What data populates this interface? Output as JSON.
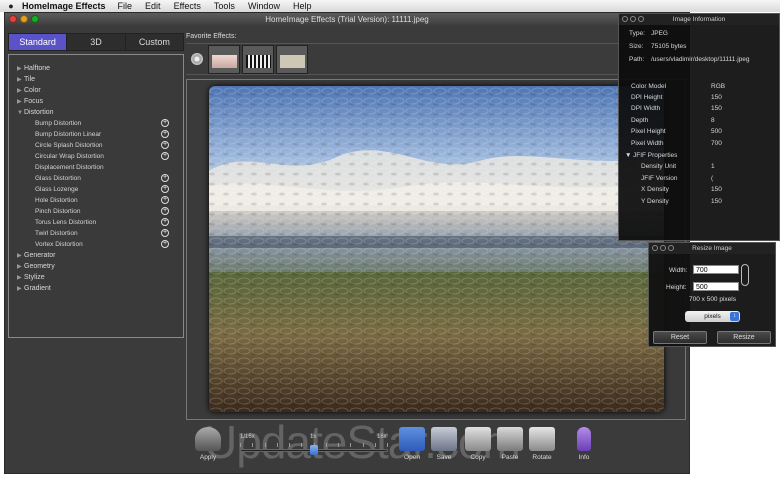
{
  "menubar": {
    "app_name": "HomeImage Effects",
    "items": [
      "File",
      "Edit",
      "Effects",
      "Tools",
      "Window",
      "Help"
    ]
  },
  "window": {
    "title": "HomeImage Effects (Trial Version): 11111.jpeg"
  },
  "tabs": [
    "Standard",
    "3D",
    "Custom"
  ],
  "effects": {
    "categories_top": [
      "Halftone",
      "Tile",
      "Color",
      "Focus"
    ],
    "expanded_category": "Distortion",
    "distortion_items": [
      "Bump Distortion",
      "Bump Distortion Linear",
      "Circle Splash Distortion",
      "Circular Wrap Distortion",
      "Displacement Distortion",
      "Glass Distortion",
      "Glass Lozenge",
      "Hole Distortion",
      "Pinch Distortion",
      "Torus Lens Distortion",
      "Twirl Distortion",
      "Vortex Distortion"
    ],
    "categories_bottom": [
      "Generator",
      "Geometry",
      "Stylize",
      "Gradient"
    ]
  },
  "favorites": {
    "label": "Favorite Effects:"
  },
  "watermark": "UpdateStar.com",
  "toolbar": {
    "apply": "Apply",
    "slider_min": "1/16x",
    "slider_mid": "1x",
    "slider_max": "16x",
    "open": "Open",
    "save": "Save",
    "copy": "Copy",
    "paste": "Paste",
    "rotate": "Rotate",
    "info": "Info"
  },
  "info_panel": {
    "title": "Image Information",
    "type_label": "Type:",
    "type_value": "JPEG",
    "size_label": "Size:",
    "size_value": "75105 bytes",
    "path_label": "Path:",
    "path_value": "/users/vladimir/desktop/11111.jpeg",
    "color_model_label": "Color Model",
    "color_model_value": "RGB",
    "dpi_height_label": "DPI Height",
    "dpi_height_value": "150",
    "dpi_width_label": "DPI Width",
    "dpi_width_value": "150",
    "depth_label": "Depth",
    "depth_value": "8",
    "pixel_height_label": "Pixel Height",
    "pixel_height_value": "500",
    "pixel_width_label": "Pixel Width",
    "pixel_width_value": "700",
    "jfif_label": "JFIF Properties",
    "density_unit_label": "Density Unit",
    "density_unit_value": "1",
    "jfif_version_label": "JFIF Version",
    "jfif_version_value": "(",
    "x_density_label": "X Density",
    "x_density_value": "150",
    "y_density_label": "Y Density",
    "y_density_value": "150"
  },
  "resize_panel": {
    "title": "Resize Image",
    "width_label": "Width:",
    "width_value": "700",
    "height_label": "Height:",
    "height_value": "500",
    "dims_text": "700 x 500 pixels",
    "unit": "pixels",
    "reset": "Reset",
    "resize": "Resize"
  }
}
